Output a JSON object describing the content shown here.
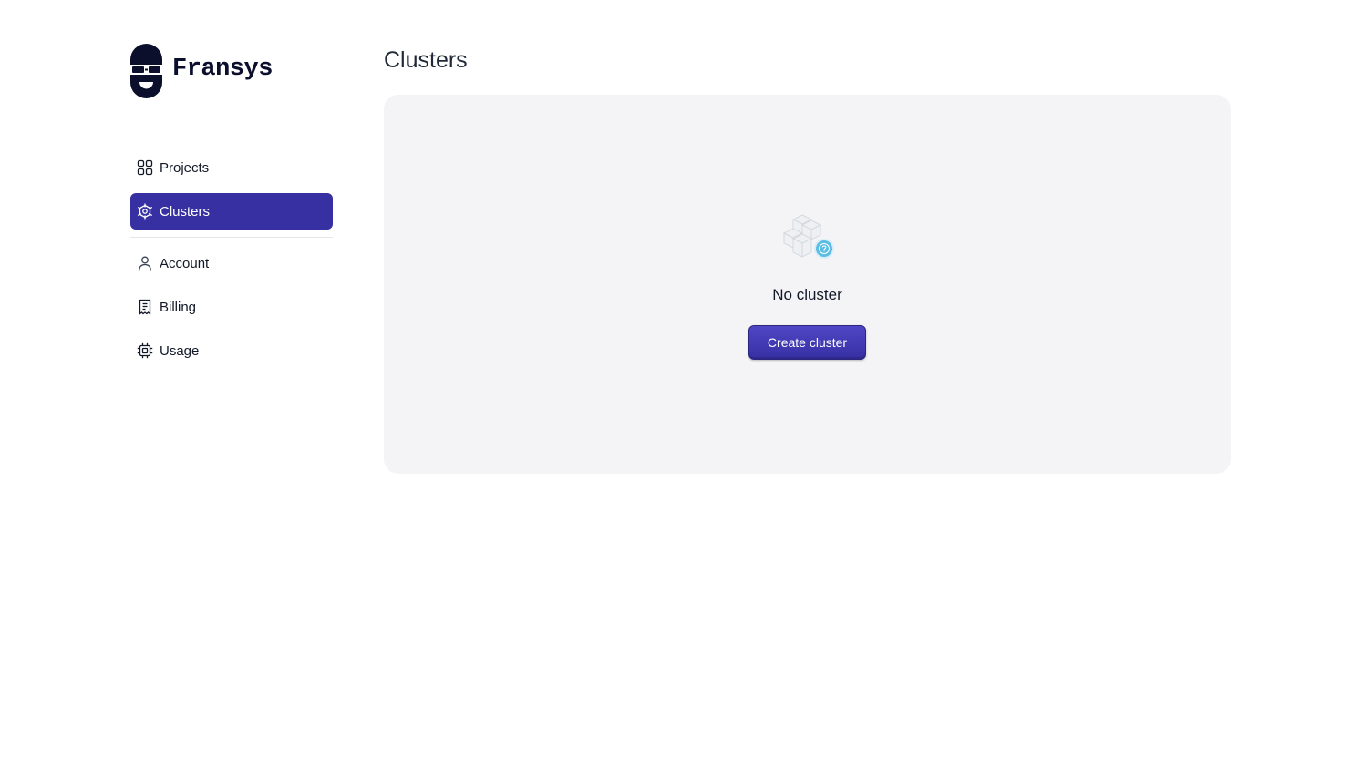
{
  "brand": {
    "name": "Fransys",
    "logo_icon": "fransys-logo-icon"
  },
  "sidebar": {
    "items": [
      {
        "label": "Projects",
        "icon": "grid-icon",
        "active": false
      },
      {
        "label": "Clusters",
        "icon": "cluster-icon",
        "active": true
      },
      {
        "label": "Account",
        "icon": "user-icon",
        "active": false
      },
      {
        "label": "Billing",
        "icon": "receipt-icon",
        "active": false
      },
      {
        "label": "Usage",
        "icon": "chip-icon",
        "active": false
      }
    ]
  },
  "main": {
    "title": "Clusters",
    "empty_state": {
      "icon": "cubes-question-icon",
      "message": "No cluster",
      "button_label": "Create cluster"
    }
  },
  "colors": {
    "accent": "#3730a3",
    "panel_bg": "#f4f4f6",
    "badge": "#5bbde4"
  }
}
